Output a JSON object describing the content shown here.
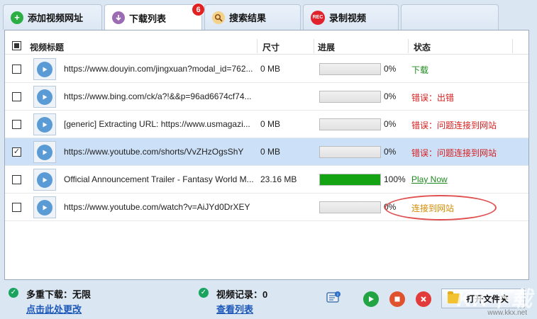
{
  "tabs": [
    {
      "label": "添加视频网址",
      "icon": "add-icon"
    },
    {
      "label": "下载列表",
      "icon": "download-icon",
      "badge": "6"
    },
    {
      "label": "搜索结果",
      "icon": "search-icon"
    },
    {
      "label": "录制视频",
      "icon": "record-icon",
      "icon_text": "REC"
    }
  ],
  "table": {
    "columns": [
      "视频标题",
      "尺寸",
      "进展",
      "状态"
    ],
    "rows": [
      {
        "title": "https://www.douyin.com/jingxuan?modal_id=762...",
        "size": "0 MB",
        "progress": 0,
        "pct": "0%",
        "status": "下载",
        "status_type": "green",
        "checked": false
      },
      {
        "title": "https://www.bing.com/ck/a?!&&p=96ad6674cf74...",
        "size": "",
        "progress": 0,
        "pct": "0%",
        "status": "错误：出错",
        "status_type": "red",
        "checked": false
      },
      {
        "title": "[generic] Extracting URL: https://www.usmagazi...",
        "size": "0 MB",
        "progress": 0,
        "pct": "0%",
        "status": "错误：问题连接到网站",
        "status_type": "red",
        "checked": false
      },
      {
        "title": "https://www.youtube.com/shorts/VvZHzOgsShY",
        "size": "0 MB",
        "progress": 0,
        "pct": "0%",
        "status": "错误：问题连接到网站",
        "status_type": "red",
        "checked": true
      },
      {
        "title": "Official Announcement Trailer - Fantasy World M...",
        "size": "23.16 MB",
        "progress": 1.0,
        "pct": "100%",
        "status": "Play Now",
        "status_type": "link",
        "checked": false
      },
      {
        "title": "https://www.youtube.com/watch?v=AiJYd0DrXEY",
        "size": "",
        "progress": 0,
        "pct": "0%",
        "status": "连接到网站",
        "status_type": "orange",
        "checked": false
      }
    ]
  },
  "bottom": {
    "multi_label": "多重下载：无限",
    "multi_link": "点击此处更改",
    "record_label": "视频记录：0",
    "record_link": "查看列表",
    "open_folder": "打开文件夹",
    "watermark": "KK下载",
    "watermark_url": "www.kkx.net"
  },
  "colors": {
    "accent": "#1aa35f",
    "error": "#d81e1e",
    "link": "#1a57b8",
    "progress": "#13a313"
  }
}
